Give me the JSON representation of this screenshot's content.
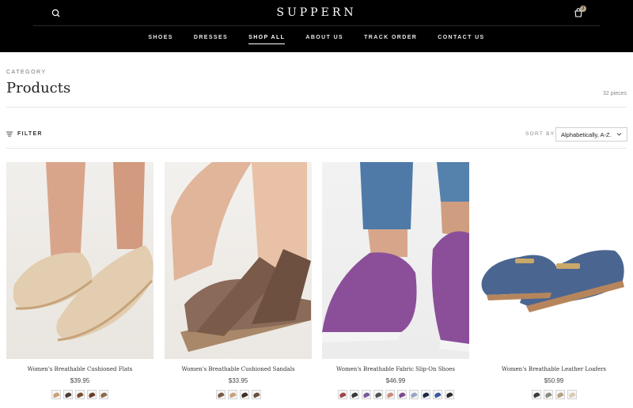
{
  "header": {
    "logo": "SUPPERN",
    "cart_count": "2",
    "nav": [
      "SHOES",
      "DRESSES",
      "SHOP ALL",
      "ABOUT US",
      "TRACK ORDER",
      "CONTACT US"
    ],
    "active_nav": "SHOP ALL",
    "icons": [
      "search-icon",
      "cart-icon"
    ]
  },
  "collection": {
    "eyebrow": "CATEGORY",
    "title": "Products",
    "count": "32 pieces"
  },
  "toolbar": {
    "filter_label": "FILTER",
    "sort_label": "SORT BY",
    "sort_value": "Alphabetically, A-Z."
  },
  "products": [
    {
      "name": "Women's Breathable Cushioned Flats",
      "price": "$39.95",
      "shoe_color": "#e2cdb0",
      "swatches": [
        "#c9a27a",
        "#4a3a35",
        "#7a4b2e",
        "#6b3e2b",
        "#8c6a4a"
      ]
    },
    {
      "name": "Women's Breathable Cushioned Sandals",
      "price": "$33.95",
      "shoe_color": "#8a6a58",
      "swatches": [
        "#7a5a44",
        "#c8a27c",
        "#3c2e29",
        "#6a4e3c"
      ]
    },
    {
      "name": "Women's Breathable Fabric Slip-On Shoes",
      "price": "$46.99",
      "shoe_color": "#8b4f9a",
      "swatches": [
        "#a04646",
        "#3a3a3a",
        "#7a5a9a",
        "#505050",
        "#cc8a7a",
        "#7a4b8a",
        "#9aa5c4",
        "#1e2a44",
        "#3a5aa0",
        "#2a2a2a"
      ]
    },
    {
      "name": "Women's Breathable Leather Loafers",
      "price": "$50.99",
      "shoe_color": "#4a6690",
      "swatches": [
        "#3a3a3a",
        "#8a8a84",
        "#b5a182",
        "#d8cbb3"
      ]
    }
  ]
}
